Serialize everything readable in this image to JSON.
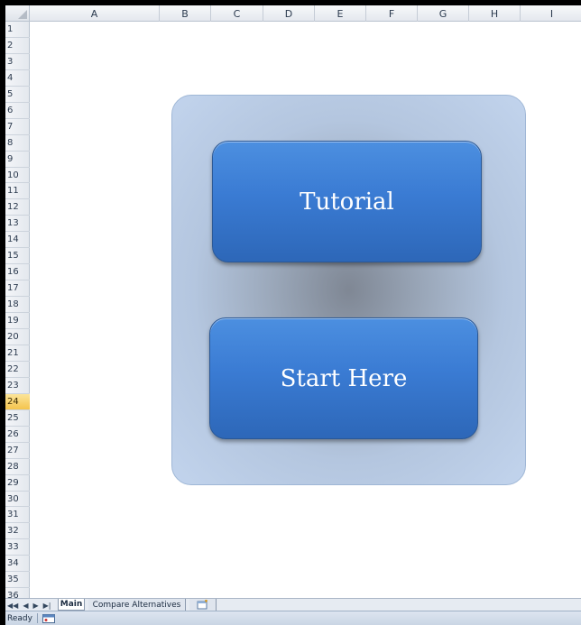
{
  "columns": [
    "A",
    "B",
    "C",
    "D",
    "E",
    "F",
    "G",
    "H",
    "I"
  ],
  "rows": [
    "1",
    "2",
    "3",
    "4",
    "5",
    "6",
    "7",
    "8",
    "9",
    "10",
    "11",
    "12",
    "13",
    "14",
    "15",
    "16",
    "17",
    "18",
    "19",
    "20",
    "21",
    "22",
    "23",
    "24",
    "25",
    "26",
    "27",
    "28",
    "29",
    "30",
    "31",
    "32",
    "33",
    "34",
    "35",
    "36"
  ],
  "active_row": "24",
  "buttons": {
    "tutorial": "Tutorial",
    "start": "Start Here"
  },
  "sheet_tabs": {
    "nav": [
      "◀◀",
      "◀",
      "▶",
      "▶|"
    ],
    "main": "Main",
    "compare": "Compare Alternatives",
    "insert_icon": "insert-sheet-icon"
  },
  "status": {
    "text": "Ready",
    "macro_icon": "macro-record-icon"
  },
  "colors": {
    "button": "#3a7bd3",
    "panel": "#c2d4ed",
    "active_row_header": "#f4c44c"
  }
}
